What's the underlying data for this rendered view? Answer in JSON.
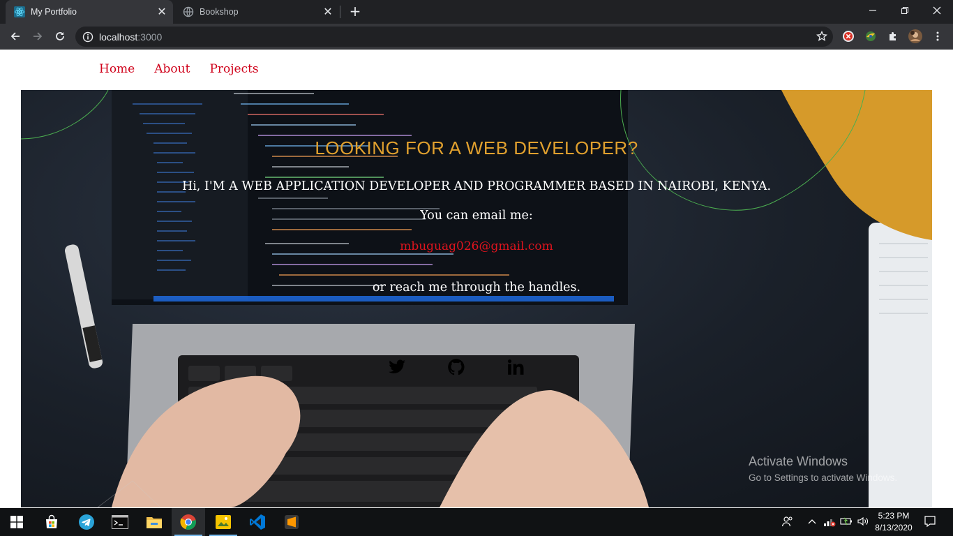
{
  "browser": {
    "tabs": [
      {
        "title": "My Portfolio",
        "active": true
      },
      {
        "title": "Bookshop",
        "active": false
      }
    ],
    "url_host": "localhost",
    "url_port": ":3000"
  },
  "page": {
    "nav": [
      {
        "label": "Home"
      },
      {
        "label": "About"
      },
      {
        "label": "Projects"
      }
    ],
    "hero": {
      "headline": "LOOKING FOR A WEB DEVELOPER?",
      "intro": "Hi, I'M A WEB APPLICATION DEVELOPER AND PROGRAMMER BASED IN NAIROBI, KENYA.",
      "email_label": "You can email me:",
      "email": "mbuguag026@gmail.com",
      "reach": "or reach me through the handles.",
      "socials": [
        {
          "icon": "twitter-icon"
        },
        {
          "icon": "github-icon"
        },
        {
          "icon": "linkedin-icon"
        }
      ]
    },
    "colors": {
      "headline": "#e0a02e",
      "nav": "#d0021b",
      "email": "#e0141e",
      "accent_blob": "#d69a2a"
    }
  },
  "watermark": {
    "line1": "Activate Windows",
    "line2": "Go to Settings to activate Windows."
  },
  "taskbar": {
    "apps": [
      "start-icon",
      "store-icon",
      "telegram-icon",
      "terminal-icon",
      "file-explorer-icon",
      "chrome-icon",
      "image-viewer-icon",
      "vscode-icon",
      "sublime-icon"
    ],
    "time": "5:23 PM",
    "date": "8/13/2020"
  }
}
